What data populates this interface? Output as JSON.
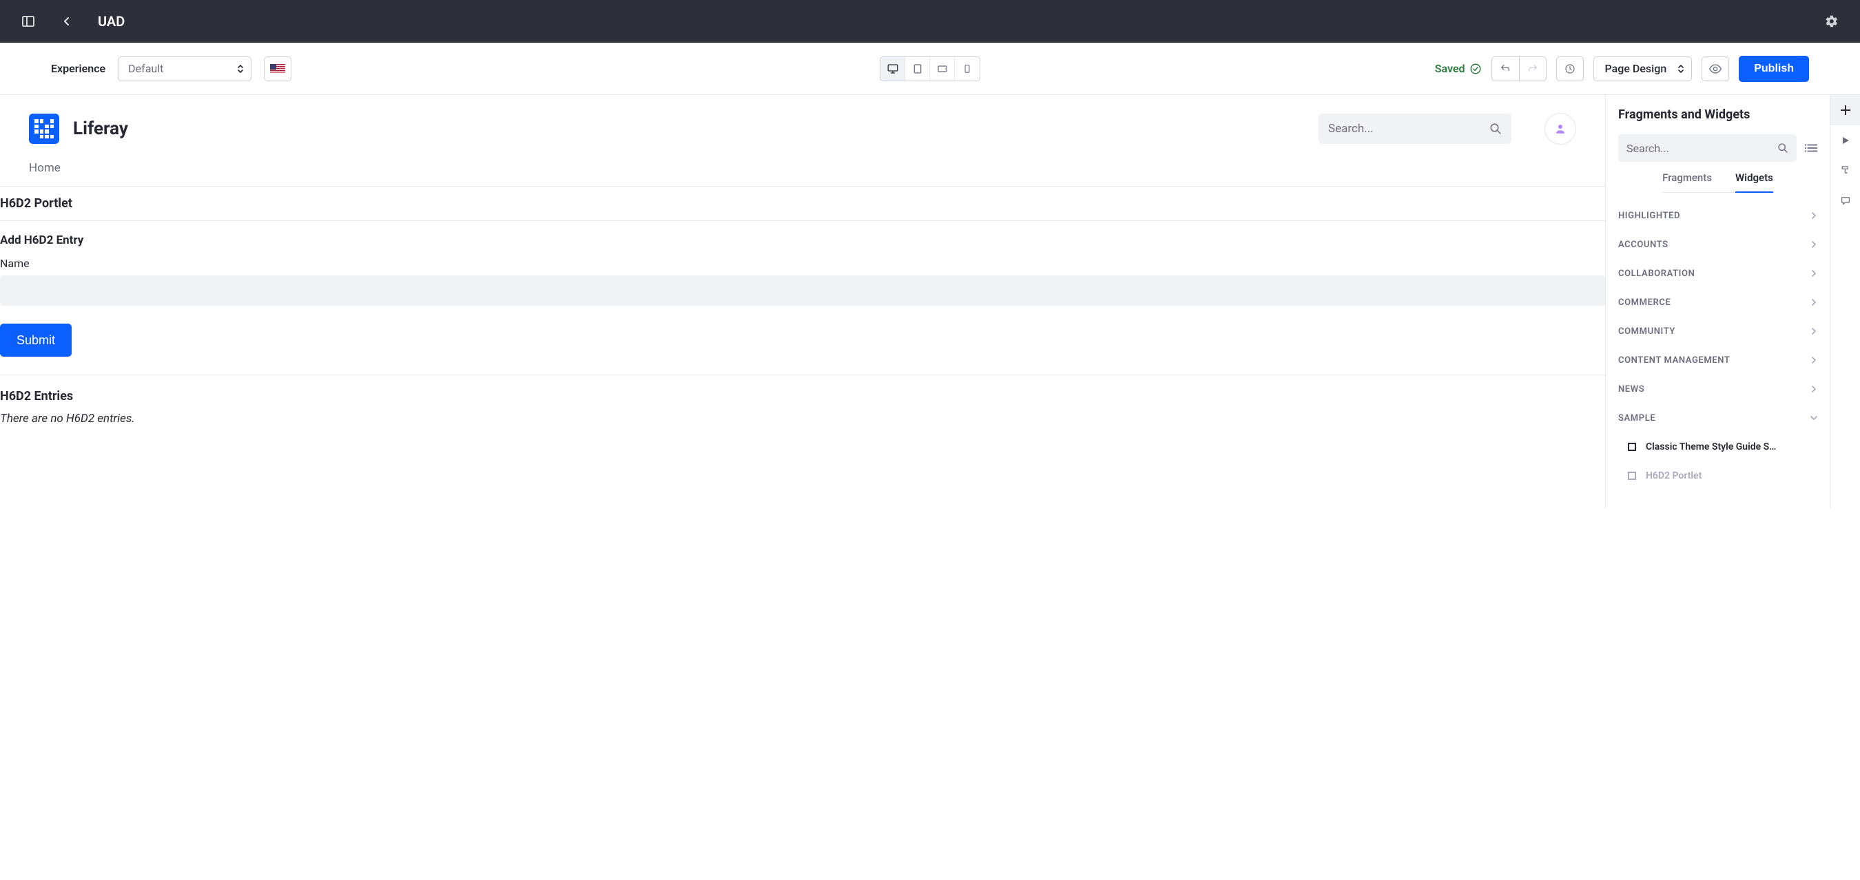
{
  "topbar": {
    "title": "UAD"
  },
  "toolbar": {
    "experience_label": "Experience",
    "experience_value": "Default",
    "saved_label": "Saved",
    "pagedesign_label": "Page Design",
    "publish_label": "Publish"
  },
  "site": {
    "title": "Liferay",
    "search_placeholder": "Search...",
    "nav_home": "Home"
  },
  "portlet": {
    "title": "H6D2 Portlet",
    "form_title": "Add H6D2 Entry",
    "name_label": "Name",
    "submit_label": "Submit",
    "entries_title": "H6D2 Entries",
    "empty_msg": "There are no H6D2 entries."
  },
  "panel": {
    "title": "Fragments and Widgets",
    "search_placeholder": "Search...",
    "tabs": {
      "fragments": "Fragments",
      "widgets": "Widgets"
    },
    "categories": [
      "HIGHLIGHTED",
      "ACCOUNTS",
      "COLLABORATION",
      "COMMERCE",
      "COMMUNITY",
      "CONTENT MANAGEMENT",
      "NEWS",
      "SAMPLE"
    ],
    "sample_items": [
      "Classic Theme Style Guide S…",
      "H6D2 Portlet"
    ]
  }
}
